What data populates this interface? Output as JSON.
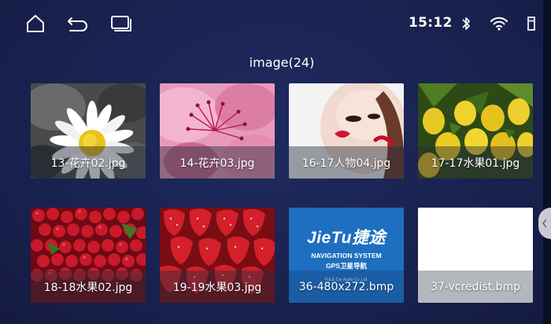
{
  "status_bar": {
    "time": "15:12",
    "icons": [
      "home-icon",
      "back-icon",
      "recent-apps-icon",
      "bluetooth-icon",
      "wifi-icon",
      "storage-icon"
    ]
  },
  "gallery": {
    "title": "image(24)",
    "items": [
      {
        "name": "13-花卉02.jpg",
        "art": "daisy-photo"
      },
      {
        "name": "14-花卉03.jpg",
        "art": "pink-flower-photo"
      },
      {
        "name": "16-17人物04.jpg",
        "art": "portrait-photo"
      },
      {
        "name": "17-17水果01.jpg",
        "art": "lemons-photo"
      },
      {
        "name": "18-18水果02.jpg",
        "art": "red-berries-photo"
      },
      {
        "name": "19-19水果03.jpg",
        "art": "strawberries-photo"
      },
      {
        "name": "36-480x272.bmp",
        "art": "navigation-logo"
      },
      {
        "name": "37-vcredist.bmp",
        "art": "blank-white"
      }
    ],
    "logo": {
      "brand": "JieTu捷途",
      "line1": "NAVIGATION SYSTEM",
      "line2": "GPS卫星导航",
      "small": "FULE Car Audio Co.,Ltd."
    }
  },
  "colors": {
    "background": "#1b2352",
    "logo_blue": "#1e6fc0"
  }
}
